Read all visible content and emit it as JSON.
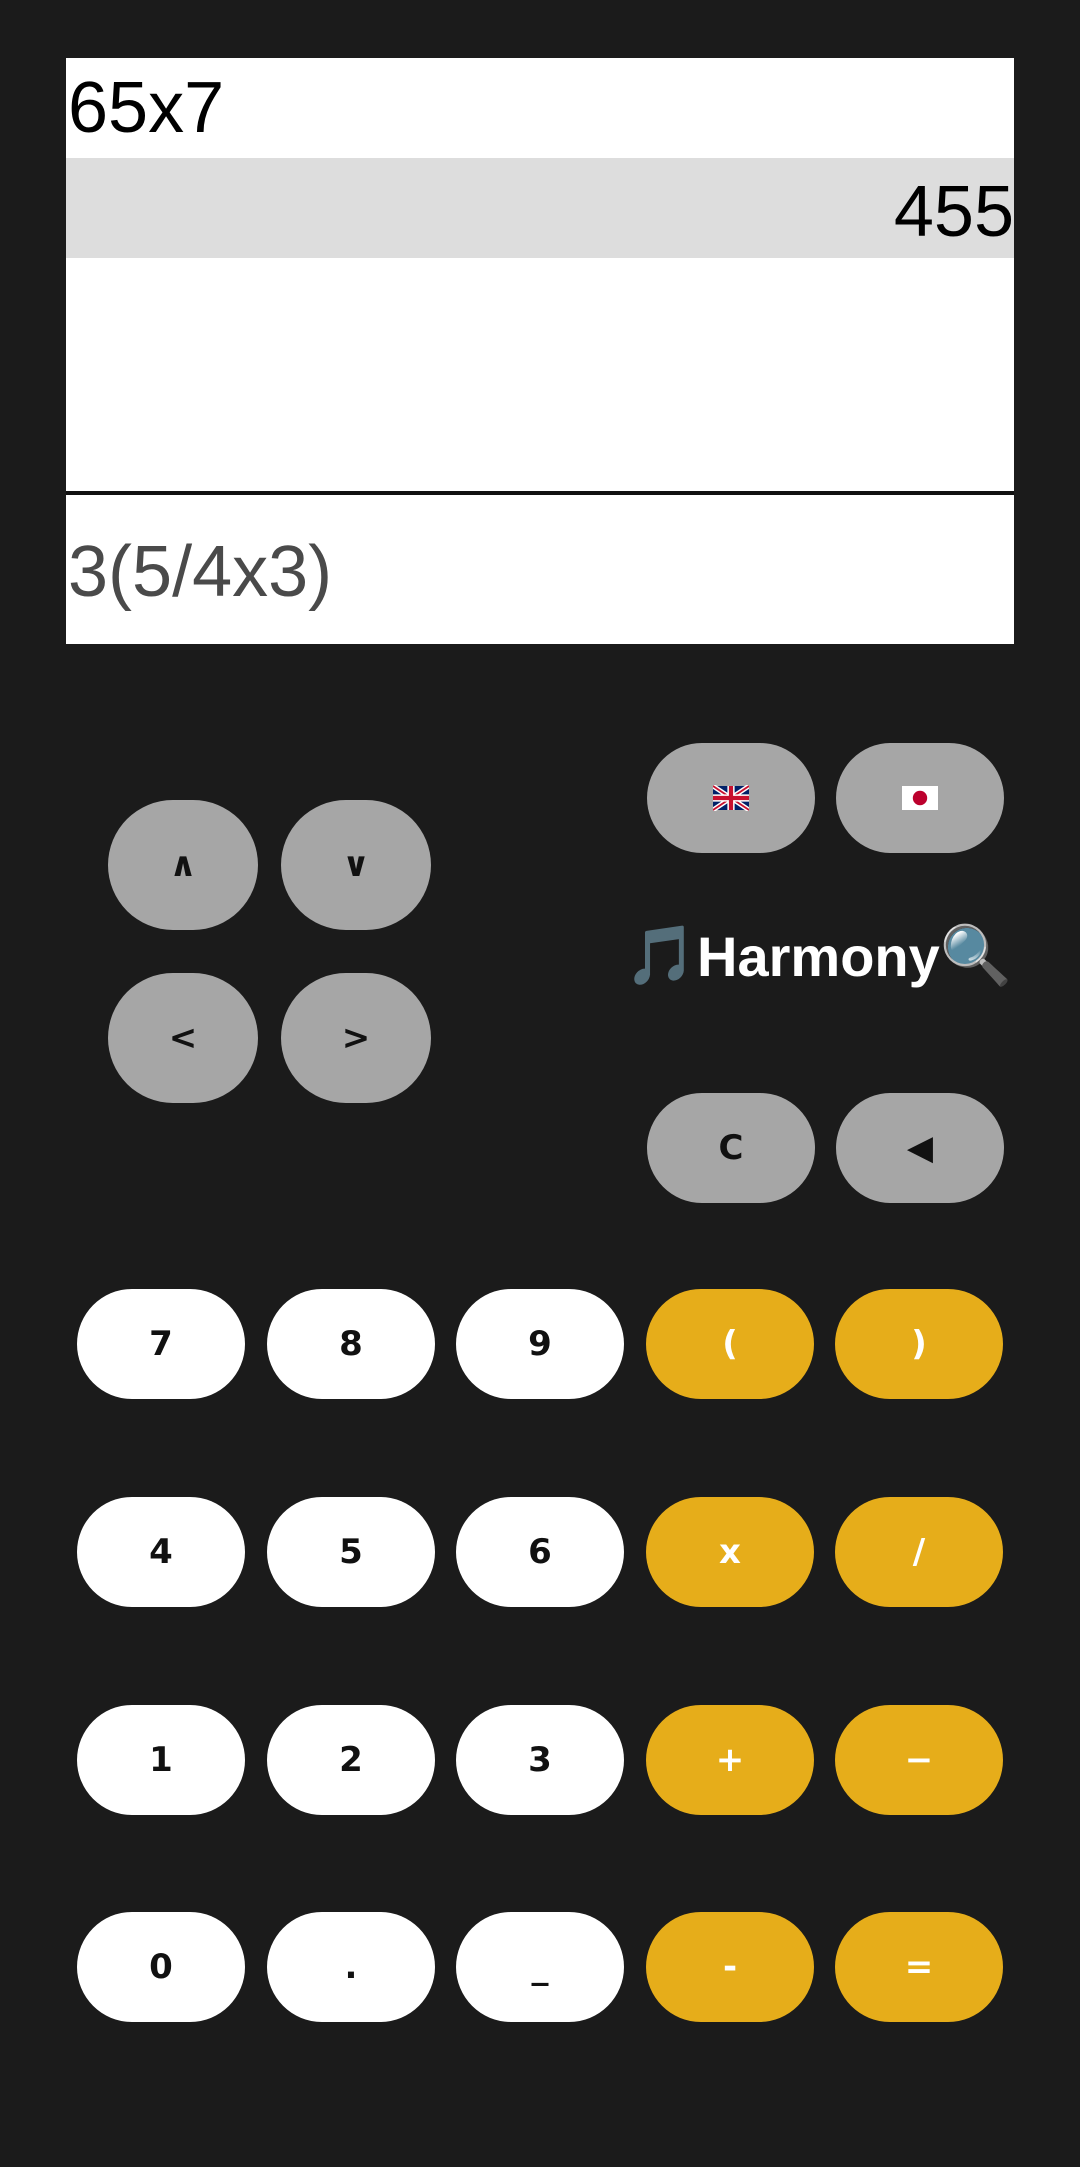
{
  "display": {
    "history_expression": "65x7",
    "history_result": "455",
    "input": "3(5/4x3)"
  },
  "nav": {
    "up": "∧",
    "down": "∨",
    "left": "<",
    "right": ">"
  },
  "language": {
    "english_icon": "uk-flag",
    "japanese_icon": "japan-flag"
  },
  "brand": {
    "music_emoji": "🎵",
    "name": "Harmony",
    "search_emoji": "🔍"
  },
  "controls": {
    "clear": "C",
    "backspace": "◀"
  },
  "keypad": {
    "rows": [
      [
        "7",
        "8",
        "9",
        "(",
        ")"
      ],
      [
        "4",
        "5",
        "6",
        "x",
        "/"
      ],
      [
        "1",
        "2",
        "3",
        "+",
        "−"
      ],
      [
        "0",
        ".",
        "_",
        "-",
        "="
      ]
    ]
  },
  "colors": {
    "background": "#1b1b1b",
    "digit_key": "#ffffff",
    "operator_key": "#e6ad1a",
    "function_key": "#a6a6a6"
  }
}
